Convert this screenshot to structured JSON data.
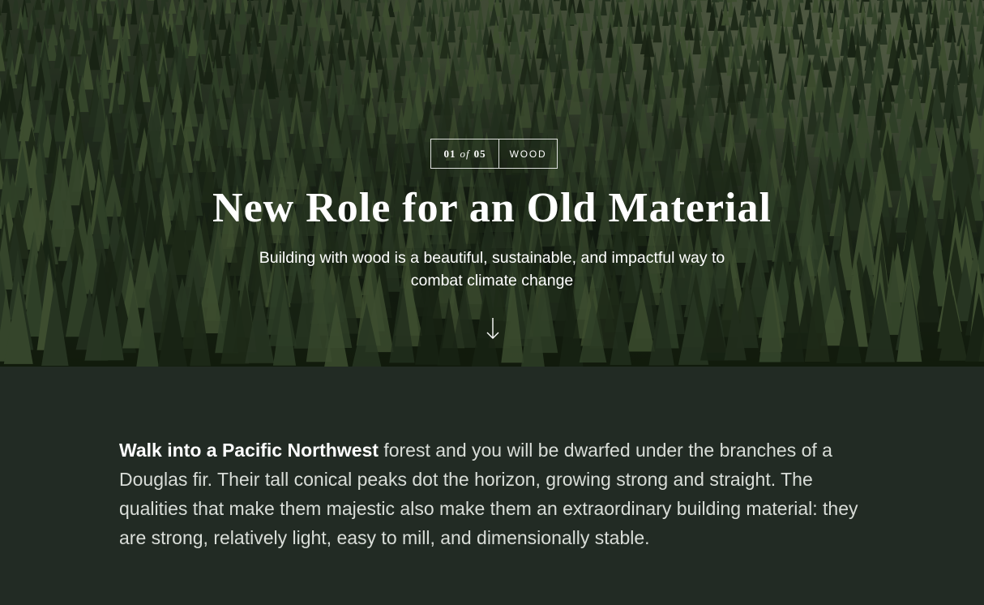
{
  "hero": {
    "counter": {
      "current": "01",
      "of": "of",
      "total": "05",
      "category": "WOOD"
    },
    "title": "New Role for an Old Material",
    "subtitle": "Building with wood is a beautiful, sustainable, and impactful way to combat climate change",
    "arrow_icon": "arrow-down-icon"
  },
  "article": {
    "lead_bold": "Walk into a Pacific Northwest",
    "lead_rest": " forest and you will be dwarfed under the branches of a Douglas fir. Their tall conical peaks dot the horizon, growing strong and straight. The qualities that make them majestic also make them an extraordinary building material: they are strong, relatively light, easy to mill, and dimensionally stable."
  },
  "colors": {
    "body_background": "#222b24",
    "hero_text": "#ffffff",
    "body_text": "#d9ddd8"
  }
}
